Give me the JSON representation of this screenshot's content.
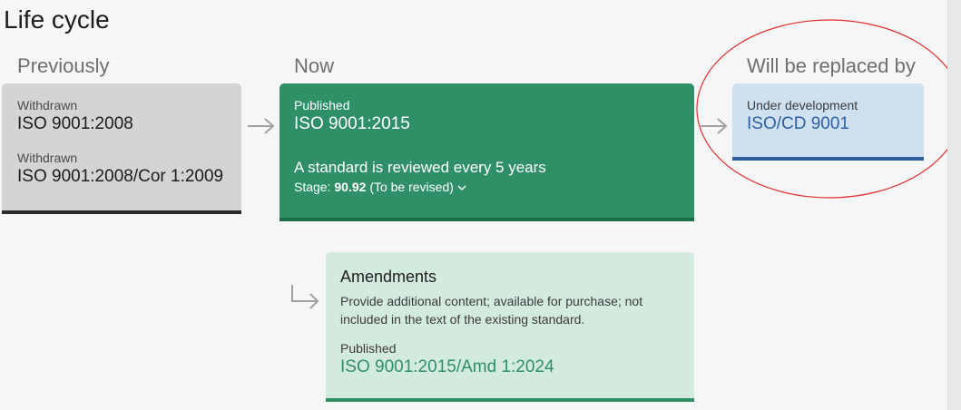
{
  "title": "Life cycle",
  "columns": {
    "previously": "Previously",
    "now": "Now",
    "next": "Will be replaced by"
  },
  "previous": [
    {
      "status": "Withdrawn",
      "ref": "ISO 9001:2008"
    },
    {
      "status": "Withdrawn",
      "ref": "ISO 9001:2008/Cor 1:2009"
    }
  ],
  "current": {
    "status": "Published",
    "ref": "ISO 9001:2015",
    "review": "A standard is reviewed every 5 years",
    "stage_label": "Stage:",
    "stage_value": "90.92",
    "stage_note": "(To be revised)",
    "stage_icon": "chevron-down-icon"
  },
  "next": {
    "status": "Under development",
    "ref": "ISO/CD 9001"
  },
  "amendments": {
    "title": "Amendments",
    "description": "Provide additional content; available for purchase; not included in the text of the existing standard.",
    "status": "Published",
    "ref": "ISO 9001:2015/Amd 1:2024"
  },
  "colors": {
    "published_green": "#2f9067",
    "development_blue": "#2f5fa3",
    "withdrawn_gray": "#d4d4d4",
    "annotation_red": "#e03030"
  },
  "icons": [
    "arrow-right-icon",
    "arrow-down-right-icon",
    "chevron-down-icon"
  ]
}
